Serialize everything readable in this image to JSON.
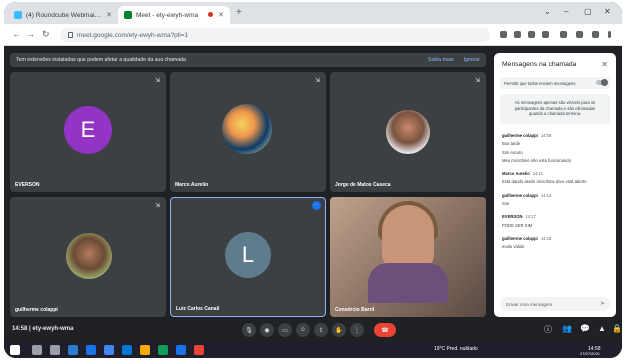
{
  "browser": {
    "tabs": [
      {
        "label": "(4) Roundcube Webmail :: Caixa",
        "active": false
      },
      {
        "label": "Meet - ety-ewyh-wma",
        "active": true
      }
    ],
    "new_tab_glyph": "+",
    "url": "meet.google.com/ety-ewyh-wma?pli=1",
    "window_controls": [
      "⌄",
      "–",
      "▢",
      "✕"
    ]
  },
  "banner": {
    "text": "Tem extensões instaladas que podem afetar a qualidade da sua chamada",
    "link_more": "Saiba mais",
    "link_ignore": "Ignorar"
  },
  "participants": [
    {
      "name": "EVERSON",
      "initial": "E",
      "avatar_color": "#9334c7",
      "type": "initial"
    },
    {
      "name": "Marco Aurelio",
      "type": "photo-art"
    },
    {
      "name": "Jorge de Matos Caseca",
      "type": "photo"
    },
    {
      "name": "guilherme colappi",
      "type": "photo"
    },
    {
      "name": "Luiz Carlos Canali",
      "initial": "L",
      "avatar_color": "#5f7c8c",
      "type": "initial",
      "active": true
    },
    {
      "name": "Consórcio Barril",
      "type": "video"
    }
  ],
  "controls": {
    "time": "14:58",
    "separator": "|",
    "meeting_code": "ety-ewyh-wma"
  },
  "chat": {
    "title": "Mensagens na chamada",
    "toggle_label": "Permitir que todos enviem mensagens",
    "notice": "As mensagens apenas são visíveis para os participantes da chamada e são eliminadas quando a chamada termina.",
    "messages": [
      {
        "sender": "guilherme colappi",
        "time": "14:09",
        "lines": [
          "Boa tarde",
          "Sim escuto",
          "Meu microfone não está funcionando"
        ]
      },
      {
        "sender": "Marco Aurelio",
        "time": "14:11",
        "lines": [
          "Está dando assim microfone da-e está aberto"
        ]
      },
      {
        "sender": "guilherme colappi",
        "time": "14:13",
        "lines": [
          "Sim"
        ]
      },
      {
        "sender": "EVERSON",
        "time": "14:17",
        "lines": [
          "PODE SER SIM"
        ]
      },
      {
        "sender": "guilherme colappi",
        "time": "14:18",
        "lines": [
          "muito válido"
        ]
      }
    ],
    "composer_placeholder": "Enviar uma mensagem"
  },
  "taskbar": {
    "weather": "19°C Pred. nublado",
    "time": "14:58",
    "date": "27/07/2021"
  },
  "colors": {
    "meet_bg": "#202124",
    "tile_bg": "#3c4043",
    "end_call": "#ea4335",
    "accent": "#8ab4f8"
  }
}
